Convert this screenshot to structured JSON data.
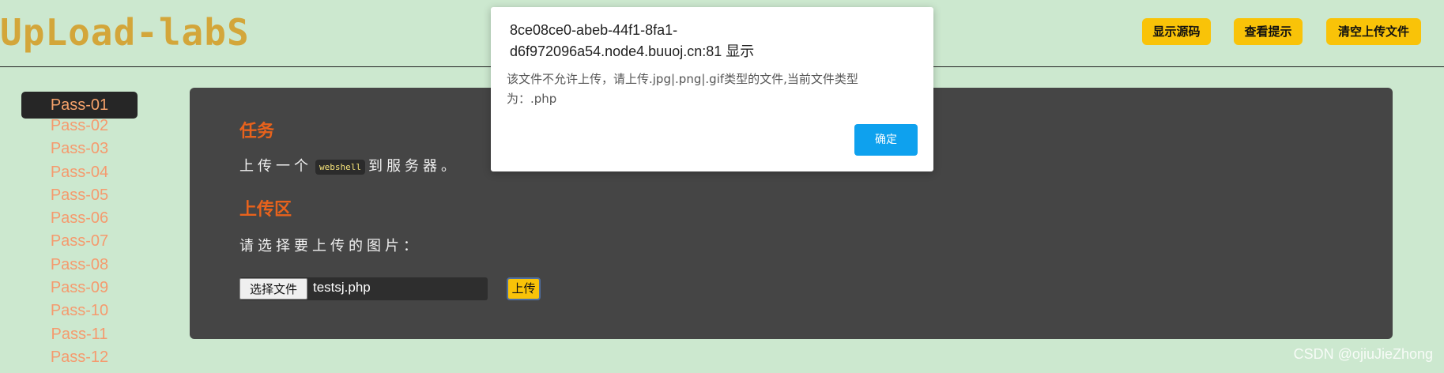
{
  "header": {
    "logo_text": "UpLoad-labS",
    "buttons": [
      "显示源码",
      "查看提示",
      "清空上传文件"
    ]
  },
  "sidebar": {
    "active": "Pass-01",
    "items": [
      "Pass-01",
      "Pass-02",
      "Pass-03",
      "Pass-04",
      "Pass-05",
      "Pass-06",
      "Pass-07",
      "Pass-08",
      "Pass-09",
      "Pass-10",
      "Pass-11",
      "Pass-12"
    ]
  },
  "main": {
    "task_heading": "任务",
    "task_prefix": "上传一个",
    "task_code": "webshell",
    "task_suffix": "到服务器。",
    "upload_heading": "上传区",
    "choose_label": "请选择要上传的图片：",
    "file_button": "选择文件",
    "file_name": "testsj.php",
    "upload_button": "上传"
  },
  "dialog": {
    "title": "8ce08ce0-abeb-44f1-8fa1-d6f972096a54.node4.buuoj.cn:81 显示",
    "message": "该文件不允许上传，请上传.jpg|.png|.gif类型的文件,当前文件类型为：.php",
    "ok_button": "确定"
  },
  "watermark": "CSDN @ojiuJieZhong",
  "colors": {
    "background": "#cce8cf",
    "panel": "#454545",
    "accent_orange": "#e8621c",
    "button_yellow": "#f9c308",
    "dialog_button": "#0ea1ee"
  }
}
